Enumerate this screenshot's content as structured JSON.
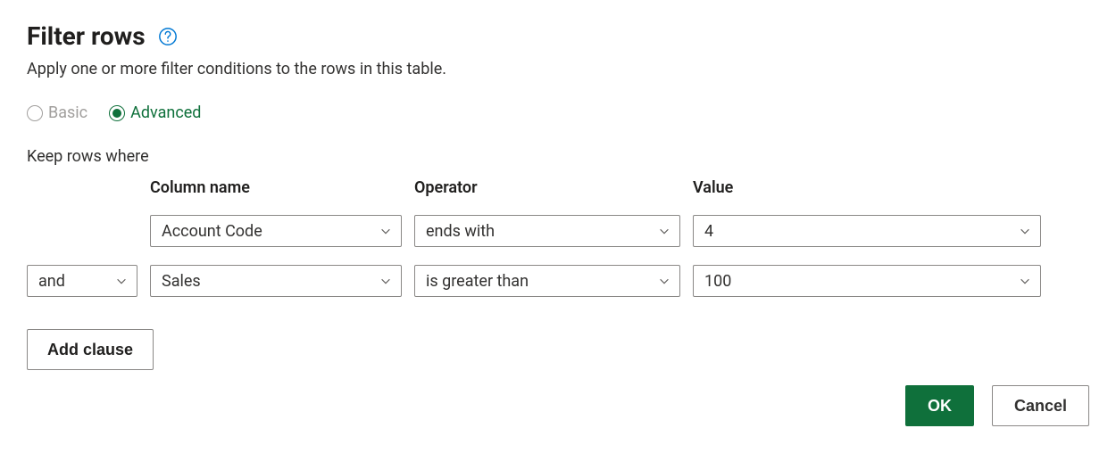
{
  "dialog": {
    "title": "Filter rows",
    "subtitle": "Apply one or more filter conditions to the rows in this table."
  },
  "mode": {
    "basic_label": "Basic",
    "advanced_label": "Advanced",
    "selected": "advanced"
  },
  "filters": {
    "keep_label": "Keep rows where",
    "headers": {
      "column": "Column name",
      "operator": "Operator",
      "value": "Value"
    },
    "rows": [
      {
        "conjunction": null,
        "column": "Account Code",
        "operator": "ends with",
        "value": "4"
      },
      {
        "conjunction": "and",
        "column": "Sales",
        "operator": "is greater than",
        "value": "100"
      }
    ],
    "add_clause_label": "Add clause"
  },
  "buttons": {
    "ok": "OK",
    "cancel": "Cancel"
  }
}
